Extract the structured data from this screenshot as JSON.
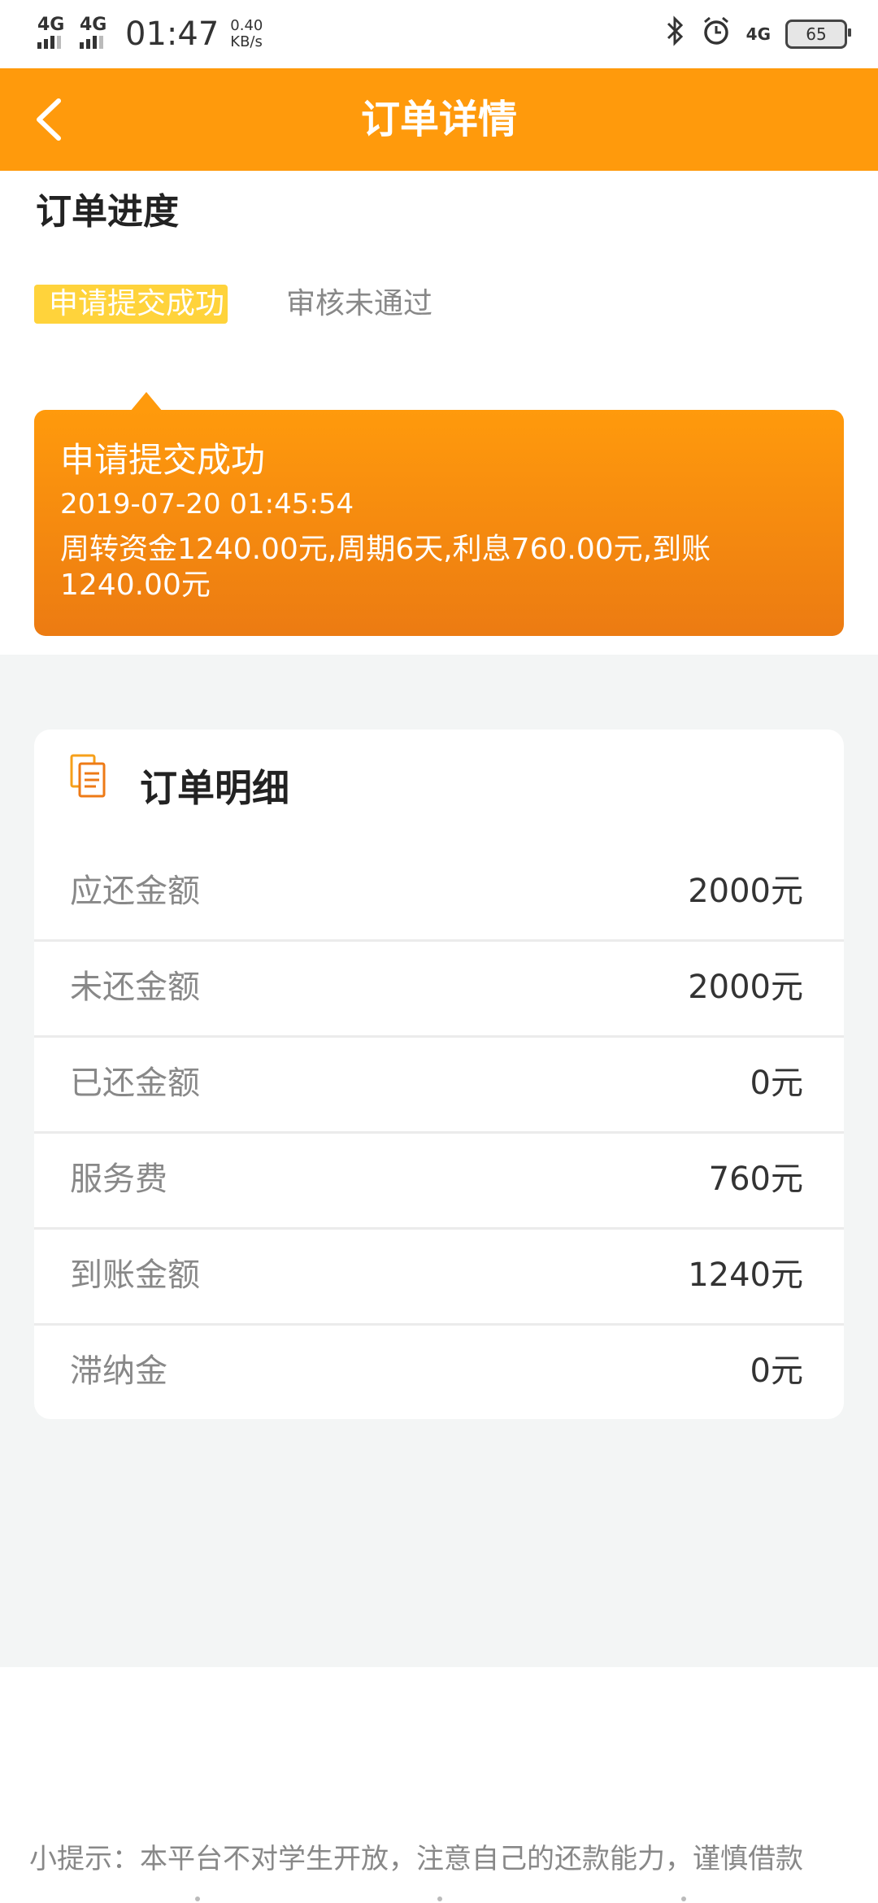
{
  "status_bar": {
    "network1": "4G",
    "network2": "4G",
    "time": "01:47",
    "speed_value": "0.40",
    "speed_unit": "KB/s",
    "network3": "4G",
    "battery": "65",
    "icons": [
      "bluetooth-icon",
      "alarm-icon"
    ]
  },
  "header": {
    "title": "订单详情",
    "back_icon": "chevron-left-icon"
  },
  "progress": {
    "title": "订单进度",
    "steps": [
      {
        "label": "申请提交成功",
        "active": true
      },
      {
        "label": "审核未通过",
        "active": false
      }
    ],
    "card": {
      "title": "申请提交成功",
      "date": "2019-07-20 01:45:54",
      "desc": "周转资金1240.00元,周期6天,利息760.00元,到账1240.00元"
    }
  },
  "detail": {
    "title": "订单明细",
    "icon": "document-icon",
    "rows": [
      {
        "label": "应还金额",
        "value": "2000元"
      },
      {
        "label": "未还金额",
        "value": "2000元"
      },
      {
        "label": "已还金额",
        "value": "0元"
      },
      {
        "label": "服务费",
        "value": "760元"
      },
      {
        "label": "到账金额",
        "value": "1240元"
      },
      {
        "label": "滞纳金",
        "value": "0元"
      }
    ]
  },
  "tip": "小提示：本平台不对学生开放，注意自己的还款能力，谨慎借款",
  "colors": {
    "brand": "#FF9A0C",
    "step_highlight": "#FFD33B",
    "active_dot": "#F2572E",
    "background_grey": "#F3F5F5"
  }
}
